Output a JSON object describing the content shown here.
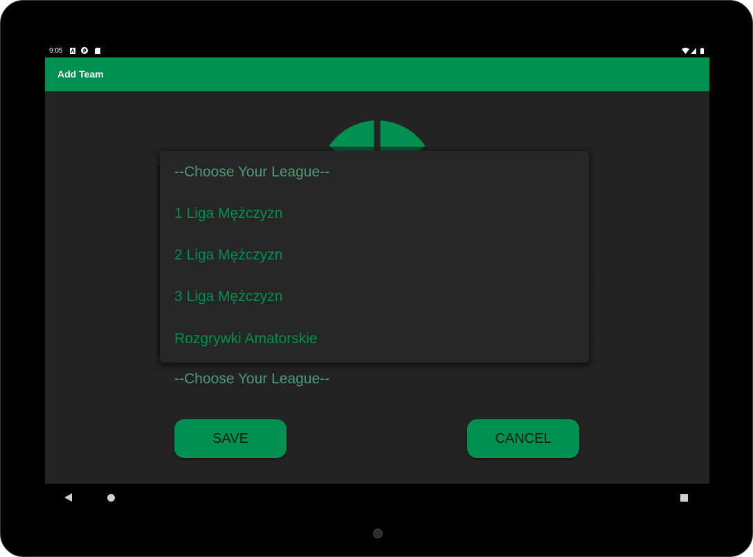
{
  "status_bar": {
    "time": "9:05",
    "left_icons": [
      "notification-a-icon",
      "notification-p-icon",
      "sd-card-icon"
    ],
    "right_icons": [
      "wifi-icon",
      "signal-icon",
      "battery-icon"
    ]
  },
  "app_bar": {
    "title": "Add Team",
    "color": "#00904f"
  },
  "form": {
    "league_spinner_value": "--Choose Your League--",
    "save_label": "SAVE",
    "cancel_label": "CANCEL"
  },
  "dropdown": {
    "items": [
      {
        "label": "--Choose Your League--"
      },
      {
        "label": "1 Liga Mężczyzn"
      },
      {
        "label": "2 Liga Mężczyzn"
      },
      {
        "label": "3 Liga Mężczyzn"
      },
      {
        "label": "Rozgrywki Amatorskie"
      }
    ]
  },
  "nav_bar": {
    "icons": [
      "back-icon",
      "home-icon",
      "recents-icon"
    ]
  },
  "colors": {
    "accent": "#00904f",
    "background": "#232323",
    "placeholder_text": "#4e9b74"
  }
}
